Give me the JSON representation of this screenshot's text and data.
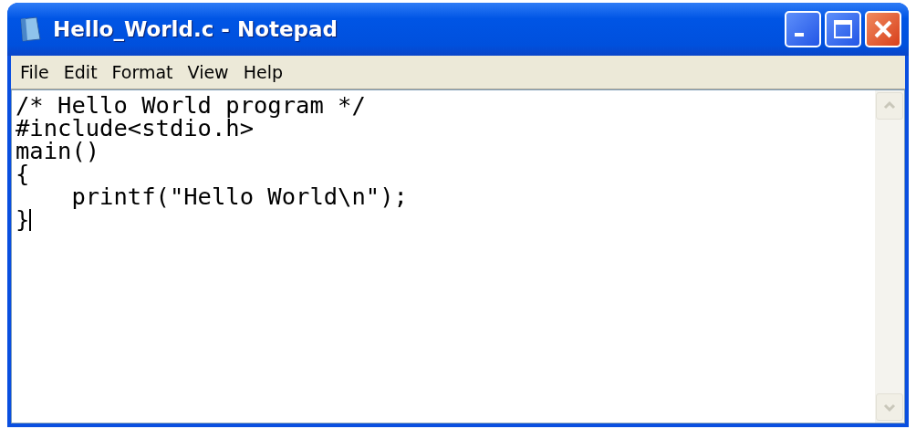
{
  "window": {
    "title": "Hello_World.c - Notepad"
  },
  "menu": [
    "File",
    "Edit",
    "Format",
    "View",
    "Help"
  ],
  "editor": {
    "lines": [
      "/* Hello World program */",
      "#include<stdio.h>",
      "main()",
      "{",
      "    printf(\"Hello World\\n\");",
      "}"
    ]
  },
  "scrollbar": {
    "disabled": true
  }
}
